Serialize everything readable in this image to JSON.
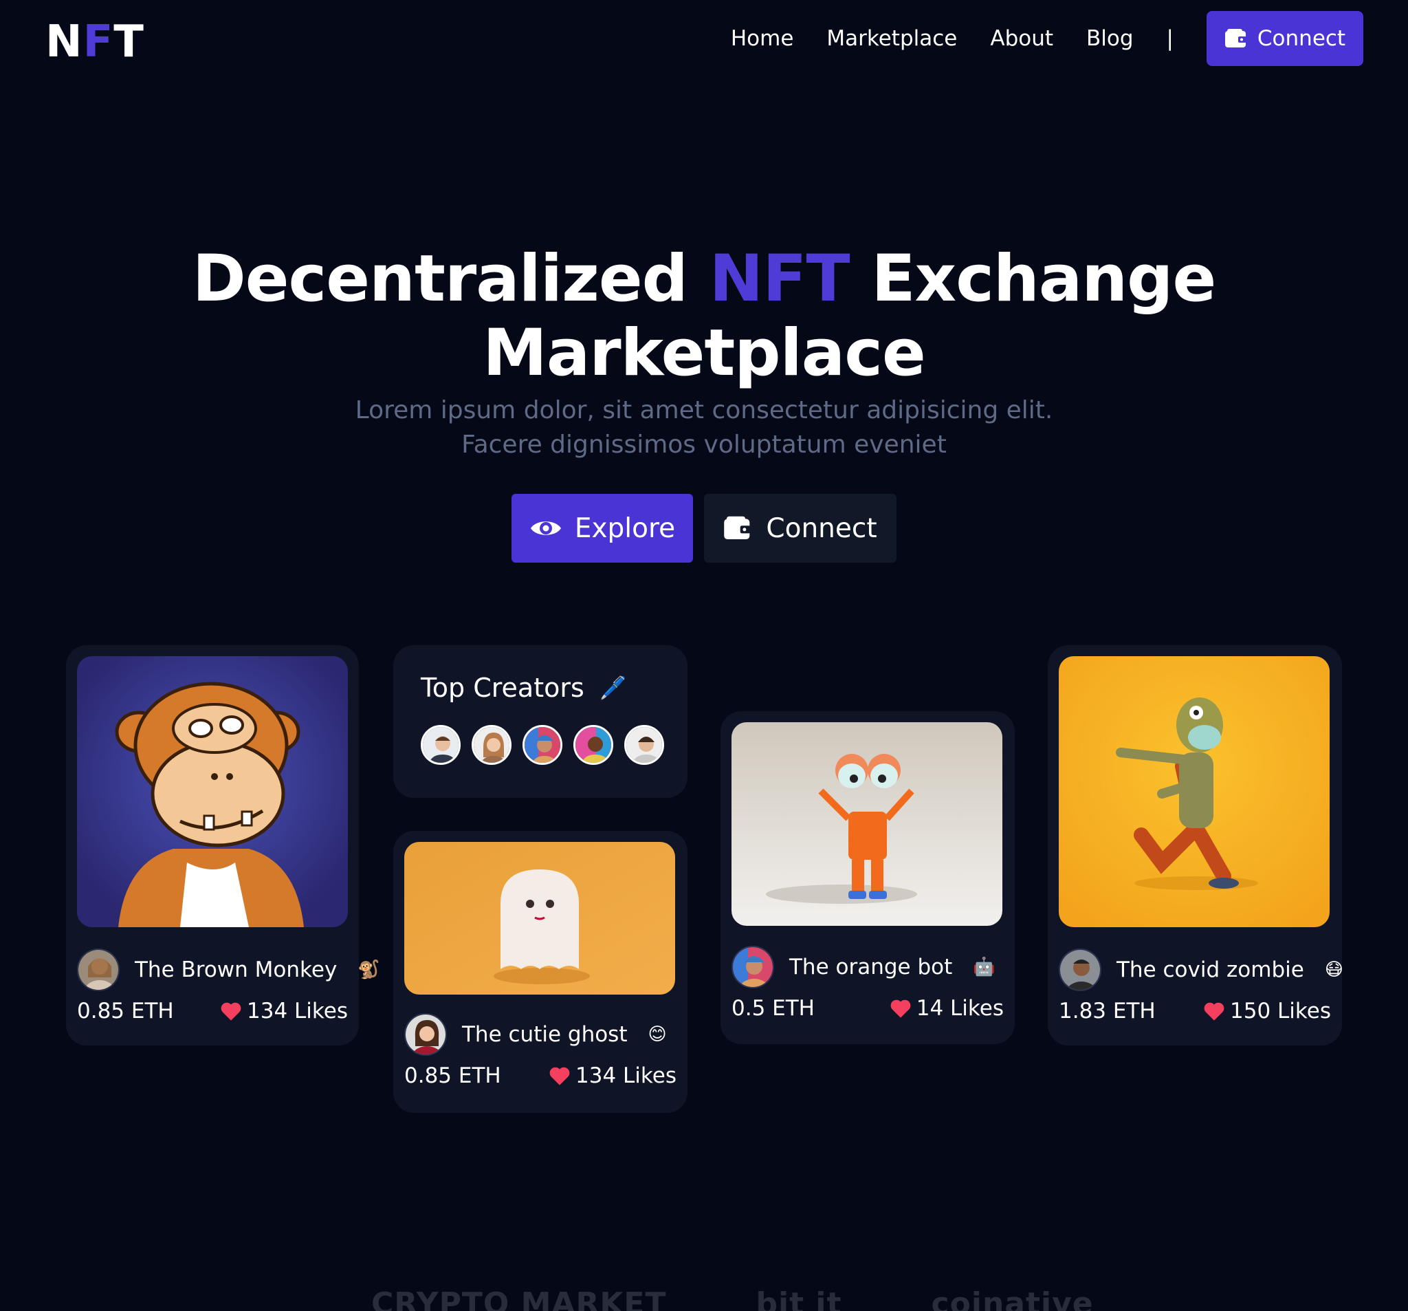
{
  "nav": {
    "logo_n": "N",
    "logo_f": "F",
    "logo_t": "T",
    "links": [
      "Home",
      "Marketplace",
      "About",
      "Blog"
    ],
    "separator": "|",
    "connect_label": "Connect"
  },
  "hero": {
    "title_part1": "Decentralized",
    "title_accent": "NFT",
    "title_part2": "Exchange",
    "title_line2": "Marketplace",
    "subtitle": "Lorem ipsum dolor, sit amet consectetur adipisicing elit. Facere dignissimos voluptatum eveniet",
    "explore_label": "Explore",
    "connect_label": "Connect"
  },
  "top_creators": {
    "title": "Top Creators",
    "emoji": "🖊️"
  },
  "cards": [
    {
      "name": "The Brown Monkey",
      "emoji": "🐒",
      "price": "0.85 ETH",
      "likes": "134 Likes"
    },
    {
      "name": "The cutie ghost",
      "emoji": "😊",
      "price": "0.85 ETH",
      "likes": "134 Likes"
    },
    {
      "name": "The orange bot",
      "emoji": "🤖",
      "price": "0.5 ETH",
      "likes": "14 Likes"
    },
    {
      "name": "The covid zombie",
      "emoji": "😷",
      "price": "1.83 ETH",
      "likes": "150 Likes"
    }
  ],
  "partners": [
    "CRYPTO MARKET",
    "bit it",
    "coinative"
  ],
  "colors": {
    "background": "#050816",
    "accent": "#4b34d6",
    "card": "#0f1526",
    "heart": "#f43f5e"
  }
}
